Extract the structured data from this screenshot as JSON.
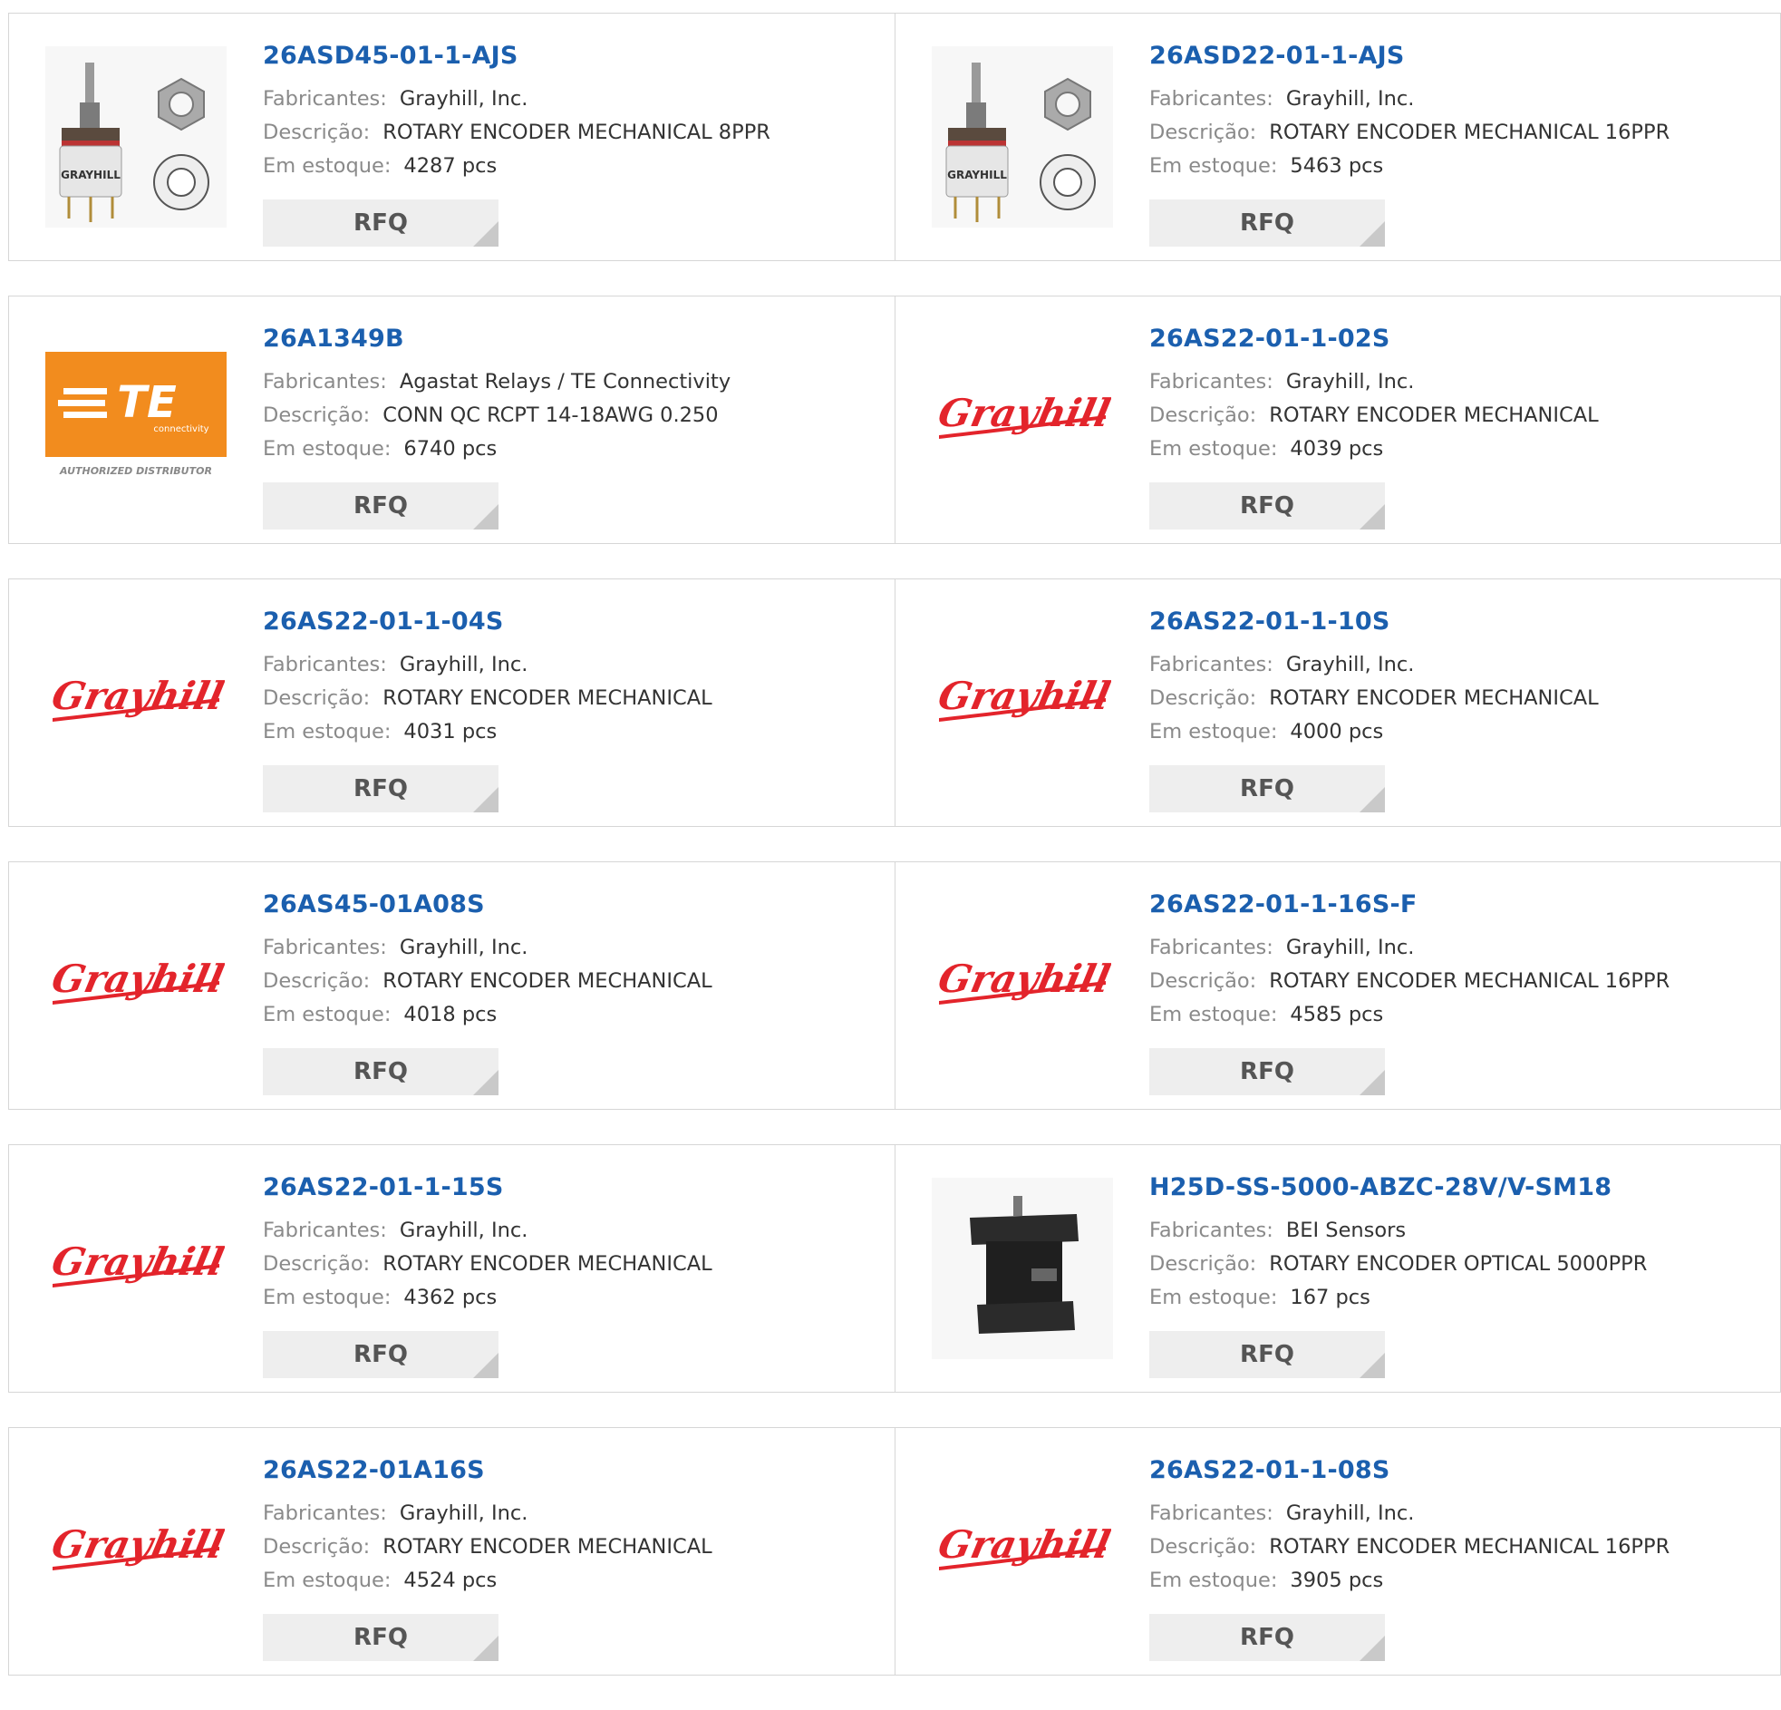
{
  "labels": {
    "manufacturer": "Fabricantes:",
    "description": "Descrição:",
    "stock": "Em estoque:",
    "rfq": "RFQ"
  },
  "colors": {
    "part_link": "#1b5fae",
    "brand_red": "#e3242b",
    "te_orange": "#f28c1e"
  },
  "rows": [
    [
      {
        "part": "26ASD45-01-1-AJS",
        "manufacturer": "Grayhill, Inc.",
        "description": "ROTARY ENCODER MECHANICAL 8PPR",
        "stock": "4287 pcs",
        "image": "encoder-photo",
        "image_text": "GRAYHILL"
      },
      {
        "part": "26ASD22-01-1-AJS",
        "manufacturer": "Grayhill, Inc.",
        "description": "ROTARY ENCODER MECHANICAL 16PPR",
        "stock": "5463 pcs",
        "image": "encoder-photo",
        "image_text": "GRAYHILL"
      }
    ],
    [
      {
        "part": "26A1349B",
        "manufacturer": "Agastat Relays / TE Connectivity",
        "description": "CONN QC RCPT 14-18AWG 0.250",
        "stock": "6740 pcs",
        "image": "te-logo",
        "image_text": "TE",
        "image_subtext": "connectivity",
        "image_caption": "AUTHORIZED DISTRIBUTOR"
      },
      {
        "part": "26AS22-01-1-02S",
        "manufacturer": "Grayhill, Inc.",
        "description": "ROTARY ENCODER MECHANICAL",
        "stock": "4039 pcs",
        "image": "grayhill-logo",
        "image_text": "Grayhill"
      }
    ],
    [
      {
        "part": "26AS22-01-1-04S",
        "manufacturer": "Grayhill, Inc.",
        "description": "ROTARY ENCODER MECHANICAL",
        "stock": "4031 pcs",
        "image": "grayhill-logo",
        "image_text": "Grayhill"
      },
      {
        "part": "26AS22-01-1-10S",
        "manufacturer": "Grayhill, Inc.",
        "description": "ROTARY ENCODER MECHANICAL",
        "stock": "4000 pcs",
        "image": "grayhill-logo",
        "image_text": "Grayhill"
      }
    ],
    [
      {
        "part": "26AS45-01A08S",
        "manufacturer": "Grayhill, Inc.",
        "description": "ROTARY ENCODER MECHANICAL",
        "stock": "4018 pcs",
        "image": "grayhill-logo",
        "image_text": "Grayhill"
      },
      {
        "part": "26AS22-01-1-16S-F",
        "manufacturer": "Grayhill, Inc.",
        "description": "ROTARY ENCODER MECHANICAL 16PPR",
        "stock": "4585 pcs",
        "image": "grayhill-logo",
        "image_text": "Grayhill"
      }
    ],
    [
      {
        "part": "26AS22-01-1-15S",
        "manufacturer": "Grayhill, Inc.",
        "description": "ROTARY ENCODER MECHANICAL",
        "stock": "4362 pcs",
        "image": "grayhill-logo",
        "image_text": "Grayhill"
      },
      {
        "part": "H25D-SS-5000-ABZC-28V/V-SM18",
        "manufacturer": "BEI Sensors",
        "description": "ROTARY ENCODER OPTICAL 5000PPR",
        "stock": "167 pcs",
        "image": "optical-encoder-photo"
      }
    ],
    [
      {
        "part": "26AS22-01A16S",
        "manufacturer": "Grayhill, Inc.",
        "description": "ROTARY ENCODER MECHANICAL",
        "stock": "4524 pcs",
        "image": "grayhill-logo",
        "image_text": "Grayhill"
      },
      {
        "part": "26AS22-01-1-08S",
        "manufacturer": "Grayhill, Inc.",
        "description": "ROTARY ENCODER MECHANICAL 16PPR",
        "stock": "3905 pcs",
        "image": "grayhill-logo",
        "image_text": "Grayhill"
      }
    ]
  ]
}
